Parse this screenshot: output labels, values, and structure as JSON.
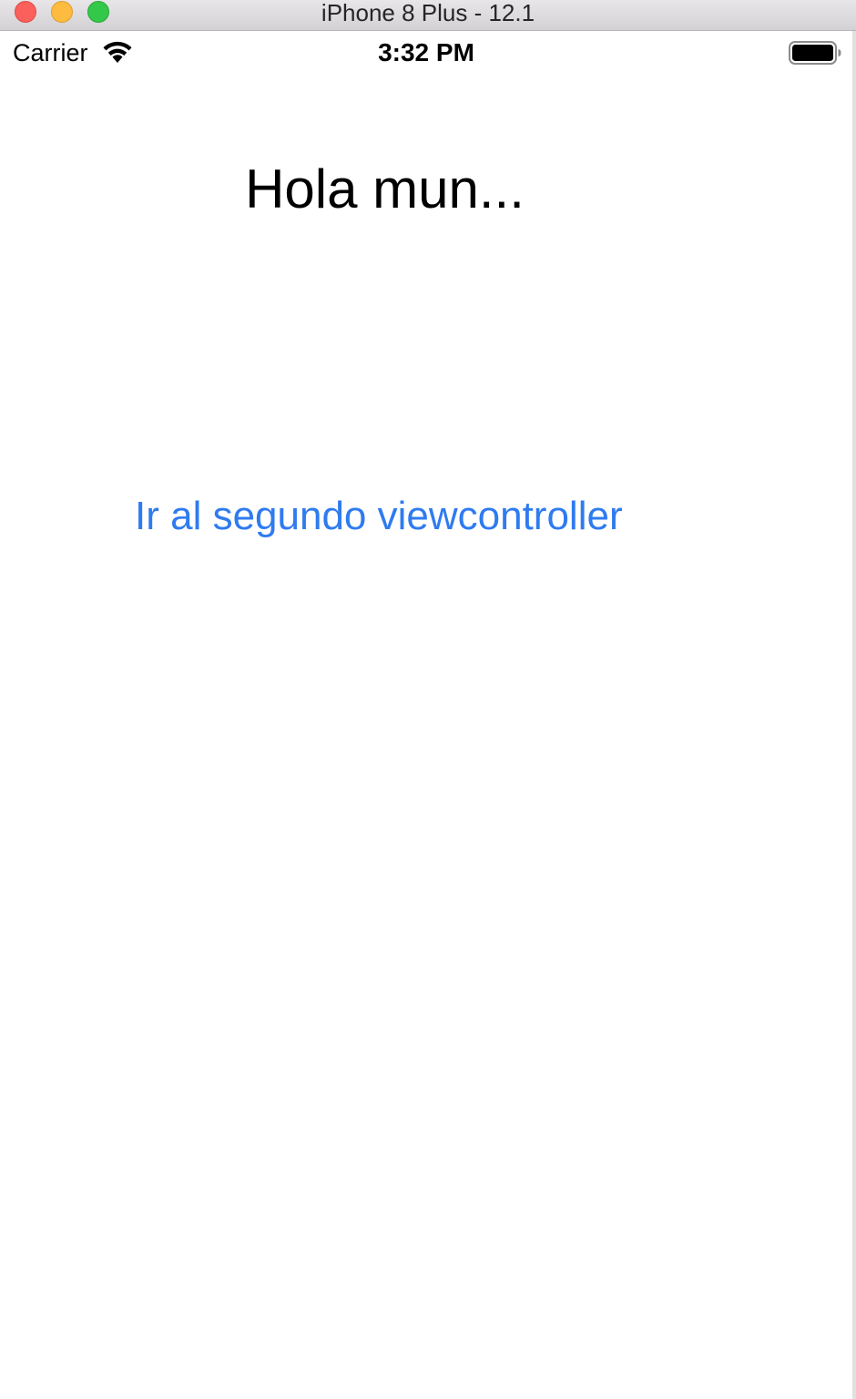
{
  "window": {
    "title": "iPhone 8 Plus - 12.1"
  },
  "status_bar": {
    "carrier": "Carrier",
    "time": "3:32 PM",
    "wifi_icon": "wifi-icon",
    "battery_icon": "battery-icon"
  },
  "content": {
    "label": "Hola mun...",
    "button_label": "Ir al segundo viewcontroller"
  },
  "colors": {
    "accent": "#2f7bf0",
    "close": "#fc605c",
    "minimize": "#fdbc40",
    "zoom": "#34c84a"
  }
}
